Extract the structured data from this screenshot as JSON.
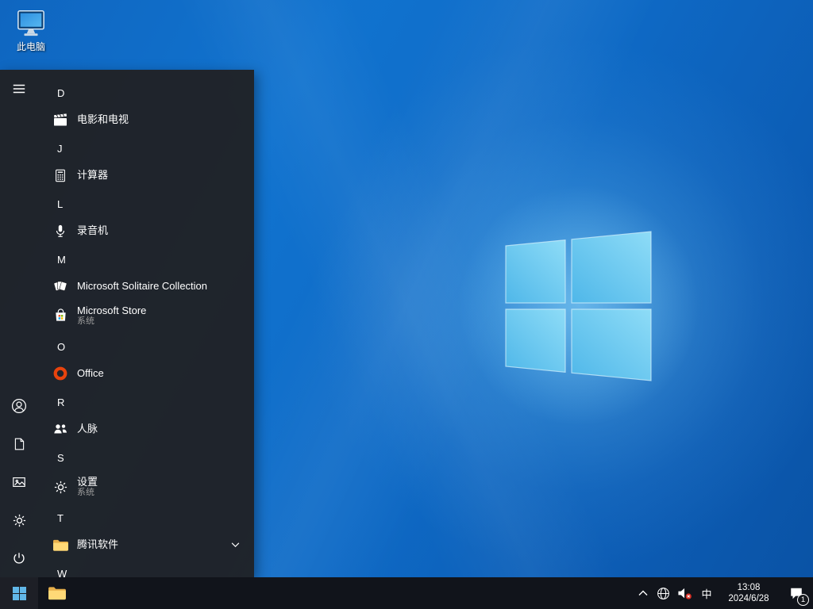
{
  "desktop": {
    "this_pc": {
      "label": "此电脑",
      "icon": "this-pc"
    }
  },
  "start_menu": {
    "rail": [
      {
        "name": "menu",
        "icon": "hamburger"
      },
      {
        "name": "account",
        "icon": "account"
      },
      {
        "name": "documents",
        "icon": "document"
      },
      {
        "name": "pictures",
        "icon": "pictures"
      },
      {
        "name": "settings",
        "icon": "gear"
      },
      {
        "name": "power",
        "icon": "power"
      }
    ],
    "sections": [
      {
        "letter": "D",
        "apps": [
          {
            "name": "movies-tv",
            "label": "电影和电视",
            "icon": "movies-tv"
          }
        ]
      },
      {
        "letter": "J",
        "apps": [
          {
            "name": "calculator",
            "label": "计算器",
            "icon": "calculator"
          }
        ]
      },
      {
        "letter": "L",
        "apps": [
          {
            "name": "voice-recorder",
            "label": "录音机",
            "icon": "microphone"
          }
        ]
      },
      {
        "letter": "M",
        "apps": [
          {
            "name": "solitaire",
            "label": "Microsoft Solitaire Collection",
            "icon": "solitaire"
          },
          {
            "name": "microsoft-store",
            "label": "Microsoft Store",
            "sublabel": "系统",
            "icon": "store"
          }
        ]
      },
      {
        "letter": "O",
        "apps": [
          {
            "name": "office",
            "label": "Office",
            "icon": "office"
          }
        ]
      },
      {
        "letter": "R",
        "apps": [
          {
            "name": "people",
            "label": "人脉",
            "icon": "people"
          }
        ]
      },
      {
        "letter": "S",
        "apps": [
          {
            "name": "settings",
            "label": "设置",
            "sublabel": "系统",
            "icon": "gear"
          }
        ]
      },
      {
        "letter": "T",
        "apps": [
          {
            "name": "tencent-folder",
            "label": "腾讯软件",
            "icon": "folder",
            "expandable": true
          }
        ]
      },
      {
        "letter": "W",
        "apps": []
      }
    ]
  },
  "taskbar": {
    "tray": {
      "ime_label": "中",
      "time": "13:08",
      "date": "2024/6/28",
      "notification_badge": "1"
    }
  },
  "colors": {
    "accent_blue": "#0078d7",
    "logo_pane": "#63c5f2",
    "menu_bg": "#202226",
    "taskbar_bg": "#11141b"
  }
}
